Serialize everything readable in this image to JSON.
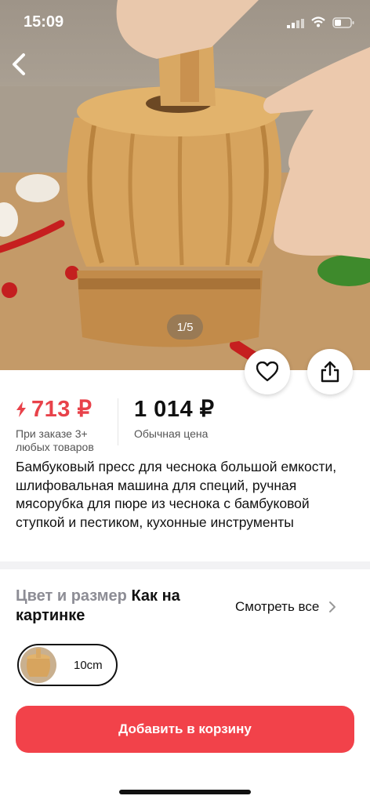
{
  "status_bar": {
    "time": "15:09"
  },
  "gallery": {
    "counter": "1/5"
  },
  "price": {
    "sale_price": "713 ₽",
    "sale_note": "При заказе 3+ любых товаров",
    "regular_price": "1 014 ₽",
    "regular_note": "Обычная цена"
  },
  "product": {
    "title": "Бамбуковый пресс для чеснока большой емкости, шлифовальная машина для специй, ручная мясорубка для пюре из чеснока с бамбуковой ступкой и пестиком, кухонные инструменты"
  },
  "options": {
    "label": "Цвет и размер",
    "value": "Как на картинке",
    "see_all": "Смотреть все",
    "variants": [
      {
        "label": "10cm",
        "selected": true
      }
    ]
  },
  "actions": {
    "add_to_cart": "Добавить в корзину"
  },
  "colors": {
    "accent": "#f2424a",
    "sale": "#e8424a"
  }
}
